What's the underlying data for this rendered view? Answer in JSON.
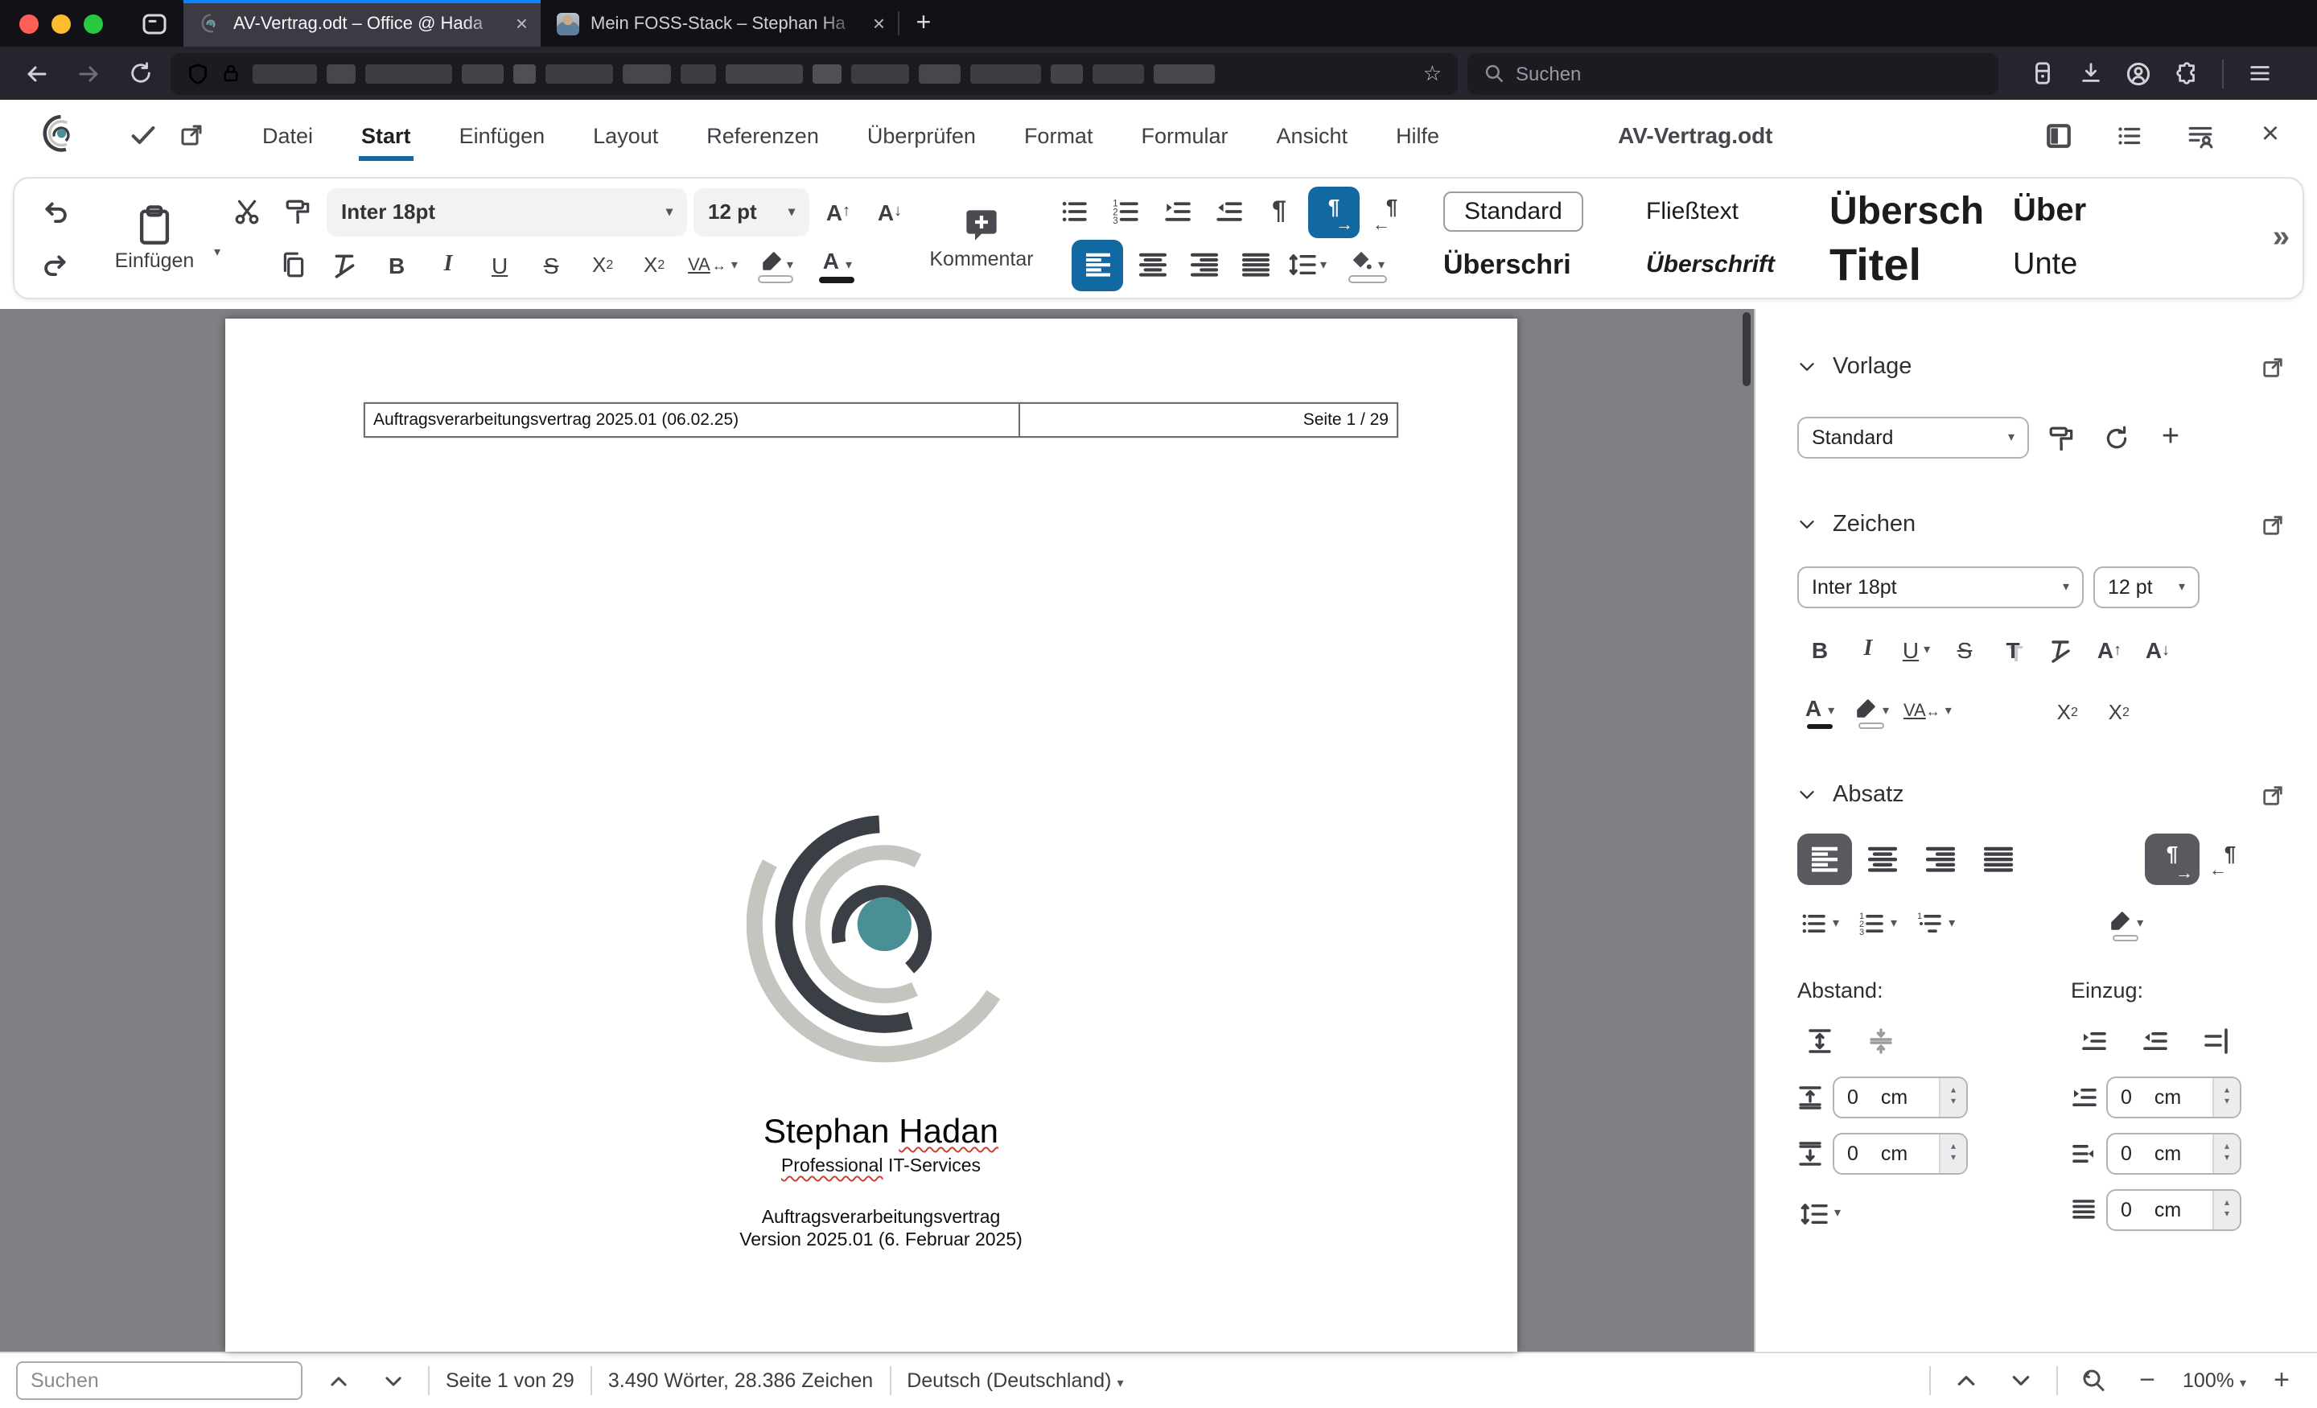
{
  "browser": {
    "tab1": {
      "title": "AV-Vertrag.odt – Office @ Hada",
      "close": "×"
    },
    "tab2": {
      "title": "Mein FOSS-Stack – Stephan Ha",
      "close": "×"
    },
    "new_tab_label": "+",
    "search_placeholder": "Suchen"
  },
  "menubar": {
    "items": [
      "Datei",
      "Start",
      "Einfügen",
      "Layout",
      "Referenzen",
      "Überprüfen",
      "Format",
      "Formular",
      "Ansicht",
      "Hilfe"
    ],
    "active_item": "Start",
    "document_title": "AV-Vertrag.odt"
  },
  "toolbar": {
    "paste_label": "Einfügen",
    "font_name": "Inter 18pt",
    "font_size": "12 pt",
    "comment_label": "Kommentar",
    "styles": [
      "Standard",
      "Fließtext",
      "Übersch",
      "Über",
      "Überschri",
      "Überschrift",
      "Titel",
      "Unte"
    ],
    "more_label": "»"
  },
  "sidebar": {
    "vorlage": {
      "title": "Vorlage",
      "style_value": "Standard"
    },
    "zeichen": {
      "title": "Zeichen",
      "font_name": "Inter 18pt",
      "font_size": "12 pt"
    },
    "absatz": {
      "title": "Absatz",
      "spacing_label": "Abstand:",
      "indent_label": "Einzug:",
      "spacing_fields": [
        {
          "value": "0",
          "unit": "cm"
        },
        {
          "value": "0",
          "unit": "cm"
        }
      ],
      "indent_fields": [
        {
          "value": "0",
          "unit": "cm"
        },
        {
          "value": "0",
          "unit": "cm"
        },
        {
          "value": "0",
          "unit": "cm"
        }
      ]
    }
  },
  "document": {
    "header_left": "Auftragsverarbeitungsvertrag 2025.01 (06.02.25)",
    "header_right": "Seite 1 / 29",
    "company_name_first": "Stephan",
    "company_name_last": "Hadan",
    "subtitle_first": "Professional",
    "subtitle_rest": "IT-Services",
    "doc_line1": "Auftragsverarbeitungsvertrag",
    "doc_line2": "Version 2025.01 (6. Februar 2025)"
  },
  "statusbar": {
    "search_placeholder": "Suchen",
    "page_info": "Seite 1 von 29",
    "word_count": "3.490 Wörter, 28.386 Zeichen",
    "language": "Deutsch (Deutschland)",
    "zoom_level": "100%"
  },
  "colors": {
    "accent_blue": "#1268a0",
    "firefox_tab_accent": "#0a84ff",
    "logo_teal": "#4a8f96",
    "logo_dark": "#3a3e45",
    "logo_grey": "#c6c4be",
    "squiggle_red": "#df3420"
  }
}
